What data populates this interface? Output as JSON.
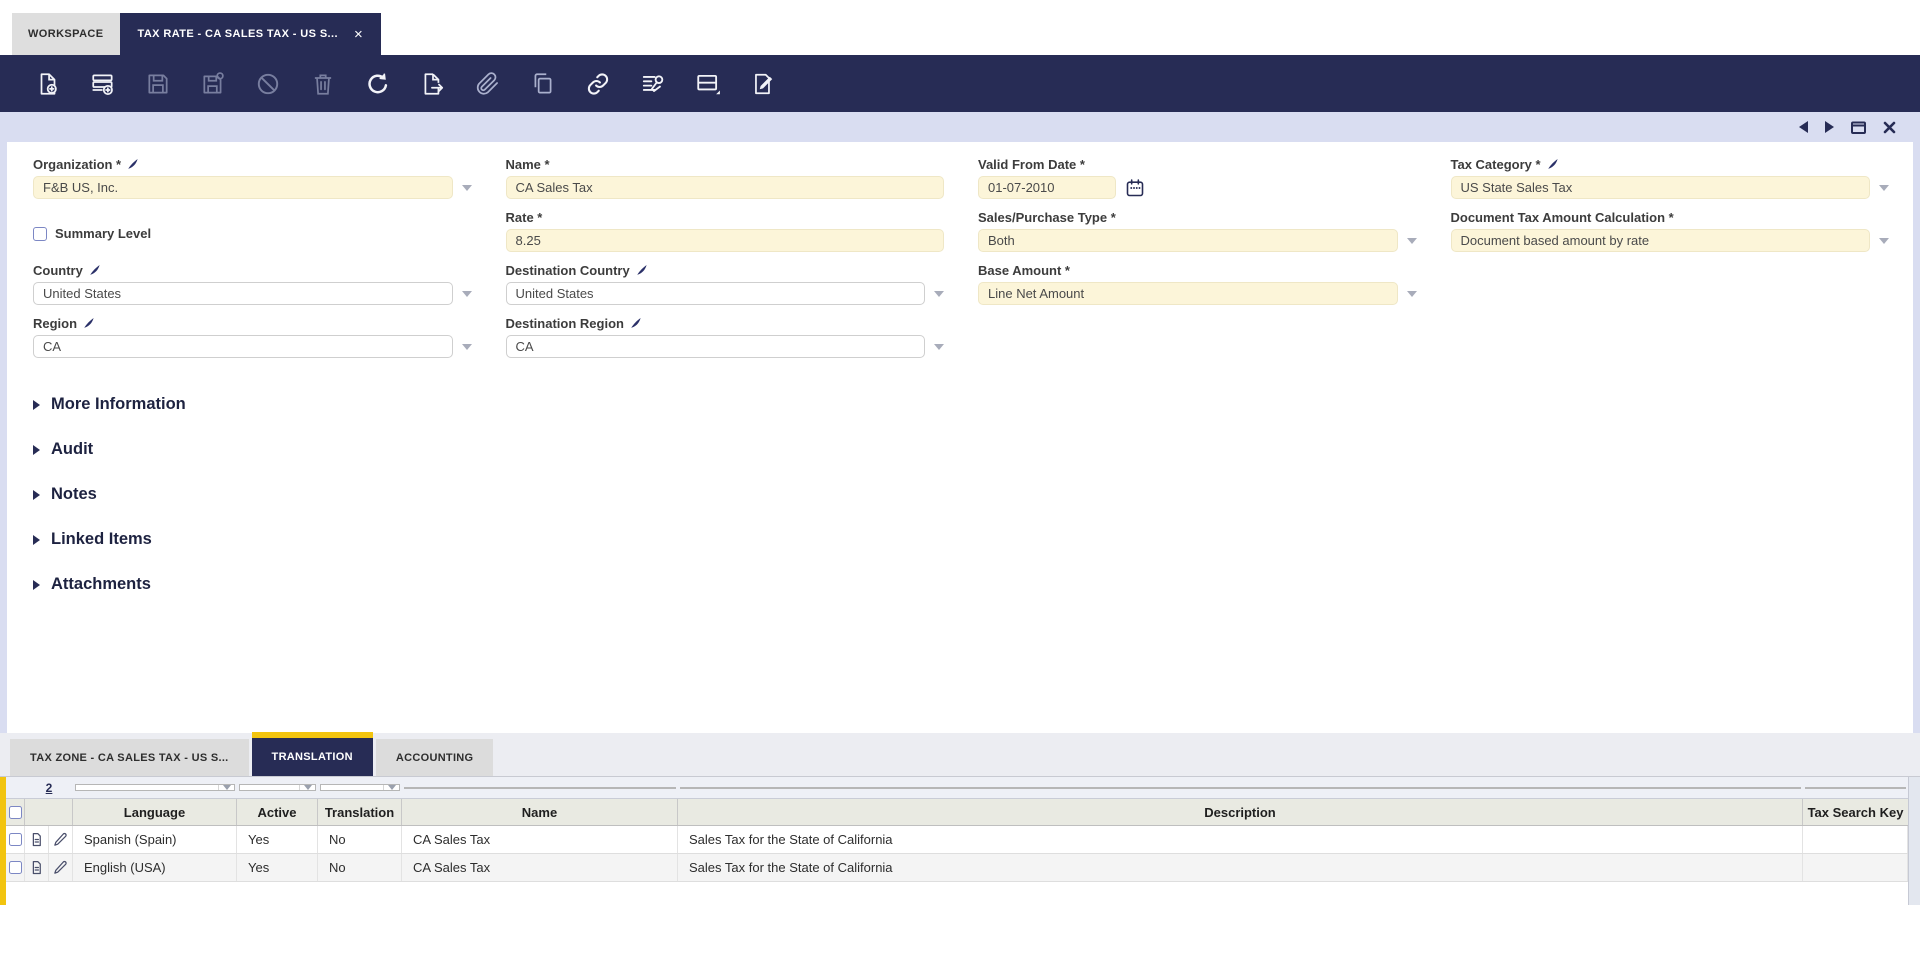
{
  "colors": {
    "navy": "#272c55",
    "accent_yellow": "#f2c40f",
    "mandatory_field": "#fcf5d9",
    "lavender": "#d9ddf1"
  },
  "top_tabs": {
    "workspace": "WORKSPACE",
    "active": "TAX RATE - CA SALES TAX - US S...",
    "close_glyph": "×"
  },
  "toolbar": {
    "icons": [
      {
        "name": "new-record",
        "enabled": true
      },
      {
        "name": "new-row",
        "enabled": true
      },
      {
        "name": "save",
        "enabled": false
      },
      {
        "name": "save-and-create",
        "enabled": false
      },
      {
        "name": "ignore-changes",
        "enabled": false
      },
      {
        "name": "delete",
        "enabled": false
      },
      {
        "name": "refresh",
        "enabled": true
      },
      {
        "name": "export",
        "enabled": true
      },
      {
        "name": "attachment",
        "enabled": true
      },
      {
        "name": "copy",
        "enabled": true
      },
      {
        "name": "link",
        "enabled": true
      },
      {
        "name": "process",
        "enabled": true
      },
      {
        "name": "window-layout",
        "enabled": true
      },
      {
        "name": "quick-form",
        "enabled": true
      }
    ]
  },
  "form": {
    "fields": {
      "organization": {
        "label": "Organization *",
        "value": "F&B US, Inc."
      },
      "name": {
        "label": "Name *",
        "value": "CA Sales Tax"
      },
      "valid_from": {
        "label": "Valid From Date *",
        "value": "01-07-2010"
      },
      "tax_category": {
        "label": "Tax Category *",
        "value": "US State Sales Tax"
      },
      "summary_level": {
        "label": "Summary Level"
      },
      "rate": {
        "label": "Rate *",
        "value": "8.25"
      },
      "sales_purchase_type": {
        "label": "Sales/Purchase Type *",
        "value": "Both"
      },
      "doc_tax_calc": {
        "label": "Document Tax Amount Calculation *",
        "value": "Document based amount by rate"
      },
      "country": {
        "label": "Country",
        "value": "United States"
      },
      "dest_country": {
        "label": "Destination Country",
        "value": "United States"
      },
      "base_amount": {
        "label": "Base Amount *",
        "value": "Line Net Amount"
      },
      "region": {
        "label": "Region",
        "value": "CA"
      },
      "dest_region": {
        "label": "Destination Region",
        "value": "CA"
      }
    },
    "sections": [
      "More Information",
      "Audit",
      "Notes",
      "Linked Items",
      "Attachments"
    ]
  },
  "detail_tabs": [
    {
      "label": "TAX ZONE - CA SALES TAX - US S...",
      "active": false
    },
    {
      "label": "TRANSLATION",
      "active": true
    },
    {
      "label": "ACCOUNTING",
      "active": false
    }
  ],
  "grid": {
    "row_count": "2",
    "headers": [
      "Language",
      "Active",
      "Translation",
      "Name",
      "Description",
      "Tax Search Key"
    ],
    "rows": [
      {
        "language": "Spanish (Spain)",
        "active": "Yes",
        "translation": "No",
        "name": "CA Sales Tax",
        "description": "Sales Tax for the State of California",
        "tax_search_key": ""
      },
      {
        "language": "English (USA)",
        "active": "Yes",
        "translation": "No",
        "name": "CA Sales Tax",
        "description": "Sales Tax for the State of California",
        "tax_search_key": ""
      }
    ]
  }
}
